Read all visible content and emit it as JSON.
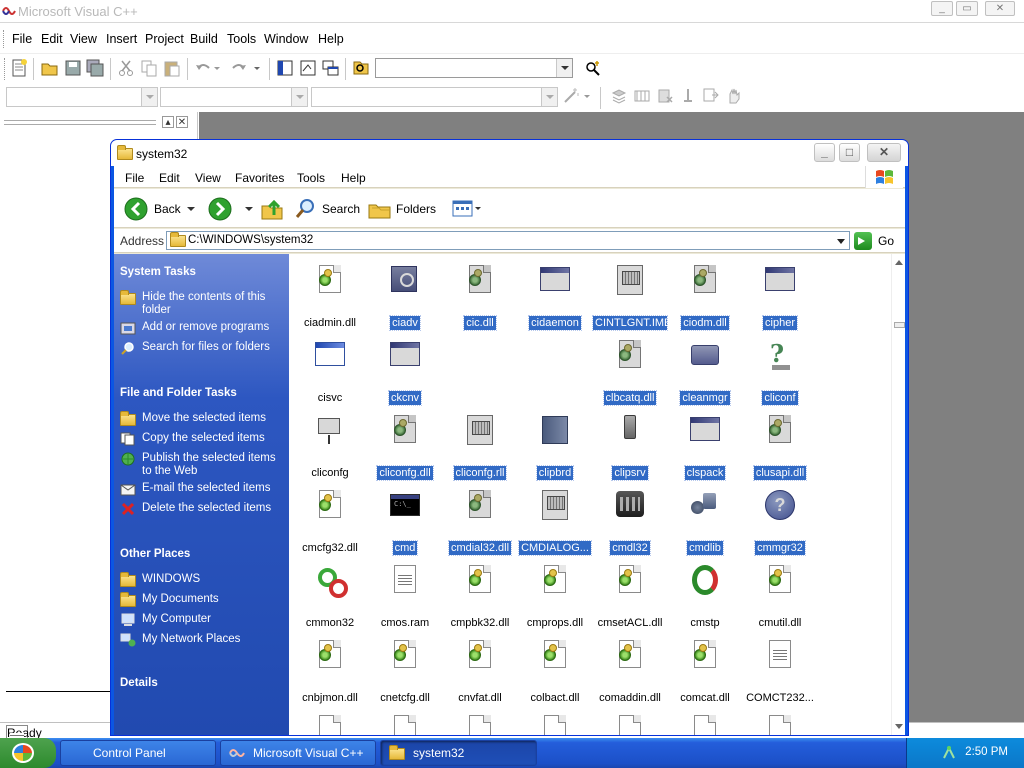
{
  "app": {
    "title": "Microsoft Visual C++",
    "menu": [
      "File",
      "Edit",
      "View",
      "Insert",
      "Project",
      "Build",
      "Tools",
      "Window",
      "Help"
    ],
    "status": "Ready"
  },
  "explorer": {
    "title": "system32",
    "menu": [
      "File",
      "Edit",
      "View",
      "Favorites",
      "Tools",
      "Help"
    ],
    "toolbar": {
      "back": "Back",
      "search": "Search",
      "folders": "Folders"
    },
    "address": {
      "label": "Address",
      "path": "C:\\WINDOWS\\system32",
      "go": "Go"
    },
    "taskpane": {
      "system_tasks": {
        "header": "System Tasks",
        "items": [
          "Hide the contents of this folder",
          "Add or remove programs",
          "Search for files or folders"
        ]
      },
      "file_tasks": {
        "header": "File and Folder Tasks",
        "items": [
          "Move the selected items",
          "Copy the selected items",
          "Publish the selected items to the Web",
          "E-mail the selected items",
          "Delete the selected items"
        ]
      },
      "other_places": {
        "header": "Other Places",
        "items": [
          "WINDOWS",
          "My Documents",
          "My Computer",
          "My Network Places"
        ]
      },
      "details": {
        "header": "Details"
      }
    },
    "files": [
      {
        "name": "ciadmin.dll",
        "icon": "dll-gear-icon",
        "selected": false
      },
      {
        "name": "ciadv",
        "icon": "search-app-icon",
        "selected": true
      },
      {
        "name": "cic.dll",
        "icon": "dll-gear-icon",
        "selected": true
      },
      {
        "name": "cidaemon",
        "icon": "window-app-icon",
        "selected": true
      },
      {
        "name": "CINTLGNT.IME",
        "icon": "ime-icon",
        "selected": true
      },
      {
        "name": "ciodm.dll",
        "icon": "dll-gear-icon",
        "selected": true
      },
      {
        "name": "cipher",
        "icon": "window-app-icon",
        "selected": true
      },
      {
        "name": "cisvc",
        "icon": "window-app-icon",
        "selected": false
      },
      {
        "name": "ckcnv",
        "icon": "window-app-icon",
        "selected": true
      },
      {
        "name": "clbcatq.dll",
        "icon": "dll-gear-icon",
        "selected": true
      },
      {
        "name": "cleanmgr",
        "icon": "disk-cleanup-icon",
        "selected": true
      },
      {
        "name": "cliconf",
        "icon": "help-config-icon",
        "selected": true
      },
      {
        "name": "cliconfg",
        "icon": "network-computer-icon",
        "selected": false
      },
      {
        "name": "cliconfg.dll",
        "icon": "dll-gear-icon",
        "selected": true
      },
      {
        "name": "cliconfg.rll",
        "icon": "ime-icon",
        "selected": true
      },
      {
        "name": "clipbrd",
        "icon": "clipbook-icon",
        "selected": true
      },
      {
        "name": "clipsrv",
        "icon": "clipbook-server-icon",
        "selected": true
      },
      {
        "name": "clspack",
        "icon": "window-app-icon",
        "selected": true
      },
      {
        "name": "clusapi.dll",
        "icon": "dll-gear-icon",
        "selected": true
      },
      {
        "name": "cmcfg32.dll",
        "icon": "dll-gear-icon",
        "selected": false
      },
      {
        "name": "cmd",
        "icon": "command-prompt-icon",
        "selected": true
      },
      {
        "name": "cmdial32.dll",
        "icon": "dll-gear-icon",
        "selected": true
      },
      {
        "name": "CMDIALOG...",
        "icon": "ime-icon",
        "selected": true
      },
      {
        "name": "cmdl32",
        "icon": "dialer-icon",
        "selected": true
      },
      {
        "name": "cmdlib",
        "icon": "cmdlib-icon",
        "selected": true
      },
      {
        "name": "cmmgr32",
        "icon": "help-icon",
        "selected": true
      },
      {
        "name": "cmmon32",
        "icon": "connection-monitor-icon",
        "selected": false
      },
      {
        "name": "cmos.ram",
        "icon": "text-file-icon",
        "selected": false
      },
      {
        "name": "cmpbk32.dll",
        "icon": "dll-gear-icon",
        "selected": false
      },
      {
        "name": "cmprops.dll",
        "icon": "dll-gear-icon",
        "selected": false
      },
      {
        "name": "cmsetACL.dll",
        "icon": "dll-gear-icon",
        "selected": false
      },
      {
        "name": "cmstp",
        "icon": "connection-installer-icon",
        "selected": false
      },
      {
        "name": "cmutil.dll",
        "icon": "dll-gear-icon",
        "selected": false
      },
      {
        "name": "cnbjmon.dll",
        "icon": "dll-gear-icon",
        "selected": false
      },
      {
        "name": "cnetcfg.dll",
        "icon": "dll-gear-icon",
        "selected": false
      },
      {
        "name": "cnvfat.dll",
        "icon": "dll-gear-icon",
        "selected": false
      },
      {
        "name": "colbact.dll",
        "icon": "dll-gear-icon",
        "selected": false
      },
      {
        "name": "comaddin.dll",
        "icon": "dll-gear-icon",
        "selected": false
      },
      {
        "name": "comcat.dll",
        "icon": "dll-gear-icon",
        "selected": false
      },
      {
        "name": "COMCT232...",
        "icon": "text-file-icon",
        "selected": false
      }
    ]
  },
  "taskbar": {
    "start": "start",
    "tasks": [
      "Control Panel",
      "Microsoft Visual C++",
      "system32"
    ],
    "clock": "2:50 PM"
  }
}
